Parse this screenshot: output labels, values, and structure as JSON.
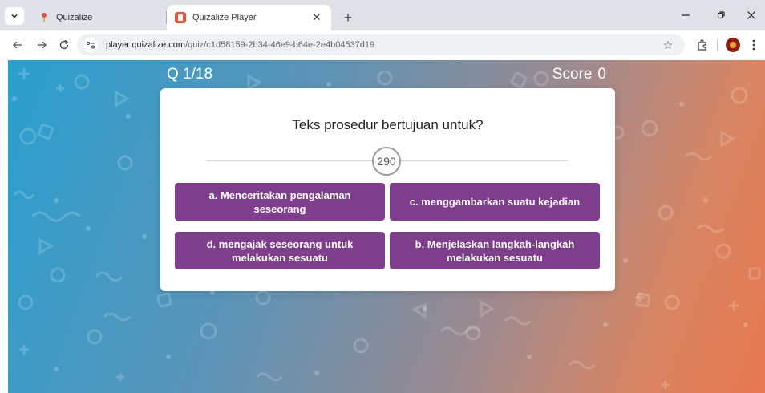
{
  "browser": {
    "tabs": [
      {
        "title": "Quizalize",
        "favicon": "quizalize-icon",
        "active": false
      },
      {
        "title": "Quizalize Player",
        "favicon": "quizalize-player-icon",
        "active": true
      }
    ],
    "url_host": "player.quizalize.com",
    "url_path": "/quiz/c1d58159-2b34-46e9-b64e-2e4b04537d19"
  },
  "quiz": {
    "counter": "Q 1/18",
    "score_label": "Score",
    "score_value": "0",
    "question": "Teks prosedur bertujuan untuk?",
    "timer": "290",
    "options": [
      {
        "label": "a. Menceritakan pengalaman seseorang"
      },
      {
        "label": "c. menggambarkan suatu kejadian"
      },
      {
        "label": "d. mengajak seseorang untuk melakukan sesuatu"
      },
      {
        "label": "b. Menjelaskan langkah-langkah melakukan sesuatu"
      }
    ]
  },
  "colors": {
    "option_bg": "#7e3e8c",
    "gradient_left": "#2aa0cf",
    "gradient_right": "#e7774f"
  }
}
